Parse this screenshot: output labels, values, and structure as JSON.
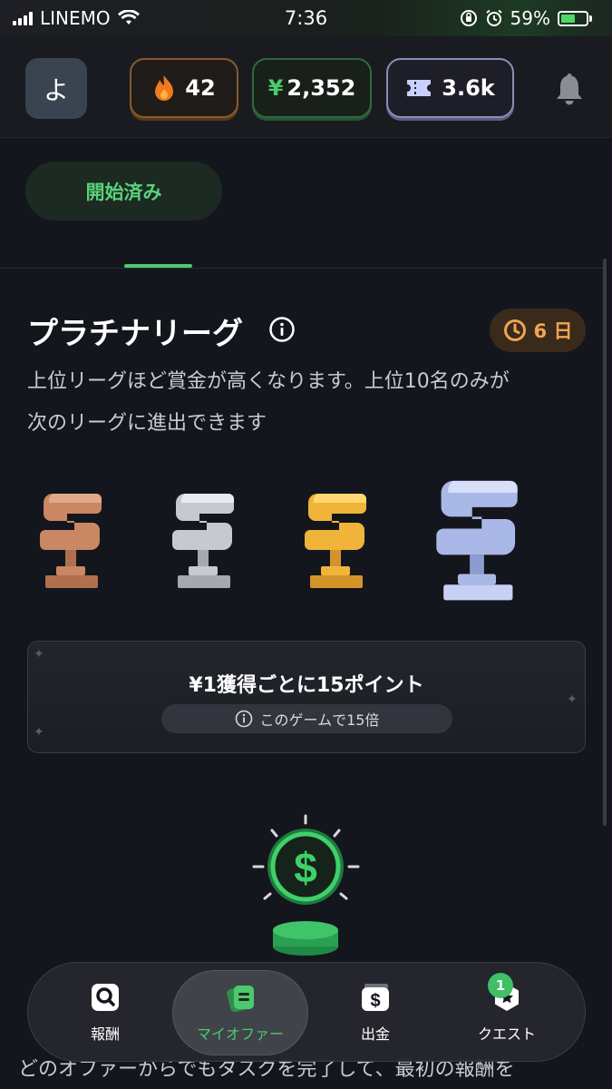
{
  "status_bar": {
    "carrier": "LINEMO",
    "time": "7:36",
    "battery": "59%",
    "battery_level": 0.59
  },
  "header": {
    "avatar_initial": "よ",
    "streak": "42",
    "balance": "2,352",
    "currency_symbol": "¥",
    "tickets": "3.6k"
  },
  "tabs": {
    "active_label": "開始済み"
  },
  "league": {
    "title": "プラチナリーグ",
    "days_left": "6 日",
    "description_line1": "上位リーグほど賞金が高くなります。上位10名のみが",
    "description_line2": "次のリーグに進出できます"
  },
  "points": {
    "title": "¥1獲得ごとに15ポイント",
    "subtitle": "このゲームで15倍"
  },
  "bottom_nav": {
    "items": [
      {
        "label": "報酬",
        "icon": "search-icon"
      },
      {
        "label": "マイオファー",
        "icon": "offers-icon"
      },
      {
        "label": "出金",
        "icon": "dollar-icon"
      },
      {
        "label": "クエスト",
        "icon": "quest-icon"
      }
    ],
    "quest_badge": "1"
  },
  "footer_text": "どのオファーからでもタスクを完了して、最初の報酬を",
  "colors": {
    "accent": "#4cc96e",
    "fire": "#f07a1e",
    "days": "#f0a550",
    "bg": "#14161d"
  }
}
